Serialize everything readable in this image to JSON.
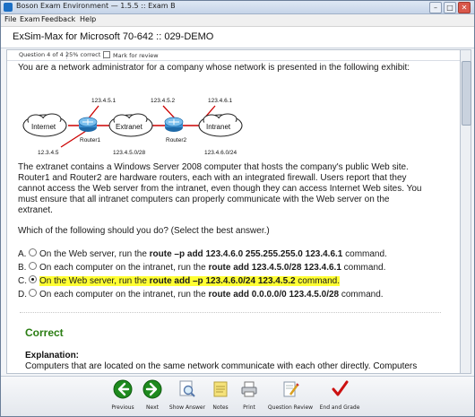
{
  "window": {
    "title": "Boson Exam Environment — 1.5.5 :: Exam B",
    "min": "–",
    "max": "□",
    "close": "✕"
  },
  "menu": [
    {
      "label": "File"
    },
    {
      "label": "Exam"
    },
    {
      "label": "Feedback"
    },
    {
      "label": "Help"
    }
  ],
  "header": {
    "exam_title": "ExSim-Max for Microsoft 70-642 :: 029-DEMO"
  },
  "status": {
    "question": "Question 4 of 4",
    "correct": "25% correct",
    "mark_label": "Mark for review"
  },
  "question": {
    "intro": "You are a network administrator for a company whose network is presented in the following exhibit:",
    "exhibit": {
      "internet": "Internet",
      "extranet": "Extranet",
      "intranet": "Intranet",
      "router1": "Router1",
      "router2": "Router2",
      "ip_r1_ext": "123.4.5.1",
      "ip_r2_ext": "123.4.5.2",
      "ip_r2_int": "123.4.6.1",
      "ip_r1_inet": "12.3.4.5",
      "net_ext": "123.4.5.0/28",
      "net_int": "123.4.6.0/24"
    },
    "body_lines": [
      "The extranet contains a Windows Server 2008 computer that hosts the company's public Web site.",
      "Router1 and Router2 are hardware routers, each with an integrated firewall. Users report that they",
      "cannot access the Web server from the intranet, even though they can access Internet Web sites. You",
      "must ensure that all intranet computers can properly communicate with the Web server on the",
      "extranet."
    ],
    "prompt": "Which of the following should you do?  (Select the best answer.)"
  },
  "answers": [
    {
      "letter": "A.",
      "pre": "On the Web server, run the ",
      "cmd": "route –p add 123.4.6.0 255.255.255.0 123.4.6.1",
      "post": " command.",
      "selected": false
    },
    {
      "letter": "B.",
      "pre": "On each computer on the intranet, run the ",
      "cmd": "route add 123.4.5.0/28 123.4.6.1",
      "post": " command.",
      "selected": false
    },
    {
      "letter": "C.",
      "pre": "On the Web server, run the ",
      "cmd": "route add –p 123.4.6.0/24 123.4.5.2",
      "post": " command.",
      "selected": true
    },
    {
      "letter": "D.",
      "pre": "On each computer on the intranet, run the ",
      "cmd": "route add 0.0.0.0/0 123.4.5.0/28",
      "post": " command.",
      "selected": false
    }
  ],
  "result": {
    "status": "Correct",
    "explanation_heading": "Explanation:",
    "explanation_text": "Computers that are located on the same network communicate with each other directly. Computers"
  },
  "toolbar": [
    {
      "label": "Previous",
      "icon": "previous-icon"
    },
    {
      "label": "Next",
      "icon": "next-icon"
    },
    {
      "label": "Show Answer",
      "icon": "magnifier-icon"
    },
    {
      "label": "Notes",
      "icon": "notes-icon"
    },
    {
      "label": "Print",
      "icon": "printer-icon"
    },
    {
      "label": "Question Review",
      "icon": "review-icon"
    },
    {
      "label": "End and Grade",
      "icon": "checkmark-icon"
    }
  ],
  "colors": {
    "correct": "#2a7d12",
    "highlight": "#ffff33",
    "router": "#3a8fd0",
    "link": "#cc0000"
  }
}
